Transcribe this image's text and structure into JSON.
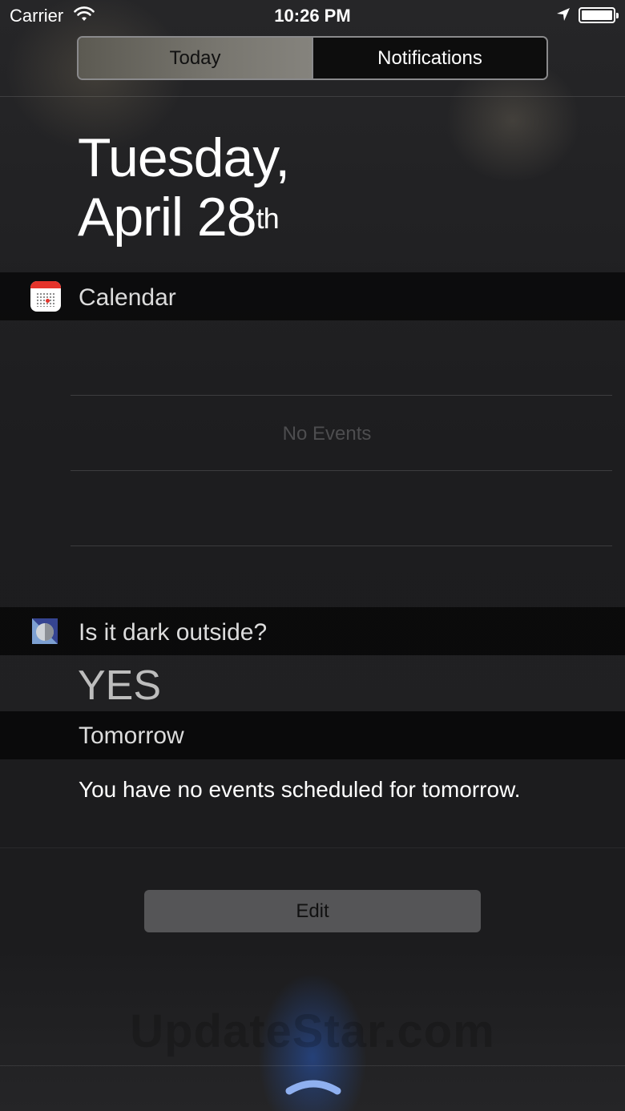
{
  "status_bar": {
    "carrier": "Carrier",
    "time": "10:26 PM",
    "icons": [
      "wifi-icon",
      "location-arrow-icon",
      "battery-icon"
    ]
  },
  "segmented_control": {
    "tabs": [
      {
        "label": "Today",
        "selected": true
      },
      {
        "label": "Notifications",
        "selected": false
      }
    ]
  },
  "date": {
    "line1": "Tuesday,",
    "line2": "April 28",
    "suffix": "th"
  },
  "calendar_widget": {
    "title": "Calendar",
    "icon": "calendar-icon",
    "empty_text": "No Events"
  },
  "dark_widget": {
    "title": "Is it dark outside?",
    "icon": "dark-outside-icon",
    "answer": "YES"
  },
  "tomorrow": {
    "title": "Tomorrow",
    "text": "You have no events scheduled for tomorrow."
  },
  "edit_button": {
    "label": "Edit"
  },
  "watermark": "UpdateStar.com",
  "colors": {
    "accent_red": "#e5332a",
    "background": "#1c1c1e",
    "header_band": "#0a0a0a"
  }
}
